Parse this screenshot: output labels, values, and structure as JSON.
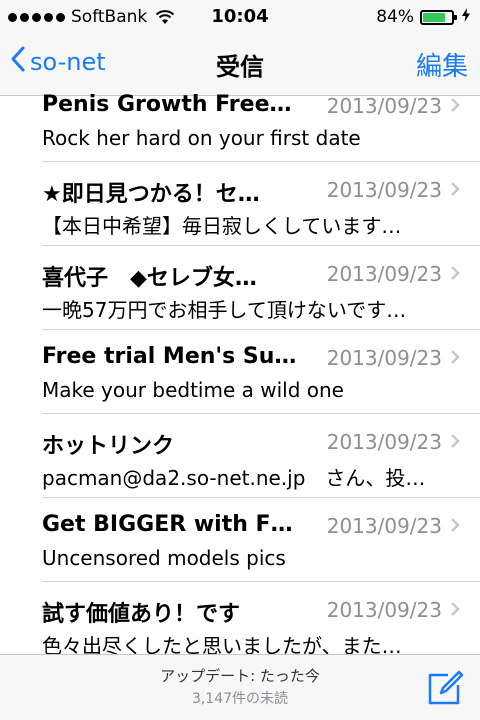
{
  "status_bar": {
    "carrier": "SoftBank",
    "time": "10:04",
    "battery_percent": "84%",
    "battery_level": 0.84,
    "signal_icon": "signal-dots-icon",
    "wifi_icon": "wifi-icon",
    "charging_icon": "bolt-icon"
  },
  "nav": {
    "back_label": "so-net",
    "title": "受信",
    "edit_label": "編集"
  },
  "messages": [
    {
      "sender": "Penis Growth Free…",
      "date": "2013/09/23",
      "preview": "Rock her hard on your first date"
    },
    {
      "sender": "★即日見つかる！セ…",
      "date": "2013/09/23",
      "preview": "【本日中希望】毎日寂しくしています…"
    },
    {
      "sender": "喜代子　◆セレブ女…",
      "date": "2013/09/23",
      "preview": "一晩57万円でお相手して頂けないです…"
    },
    {
      "sender": "Free trial Men's Su…",
      "date": "2013/09/23",
      "preview": "Make your bedtime a wild one"
    },
    {
      "sender": "ホットリンク",
      "date": "2013/09/23",
      "preview": "pacman@da2.so-net.ne.jp　さん、投…"
    },
    {
      "sender": "Get BIGGER with F…",
      "date": "2013/09/23",
      "preview": "Uncensored models pics"
    },
    {
      "sender": "試す価値あり！です",
      "date": "2013/09/23",
      "preview": "色々出尽くしたと思いましたが、また…"
    }
  ],
  "toolbar": {
    "update_status": "アップデート: たった今",
    "unread_count": "3,147件の未読"
  },
  "colors": {
    "accent": "#1a7cf5",
    "battery": "#35c759",
    "secondary_text": "#8e8e93"
  }
}
